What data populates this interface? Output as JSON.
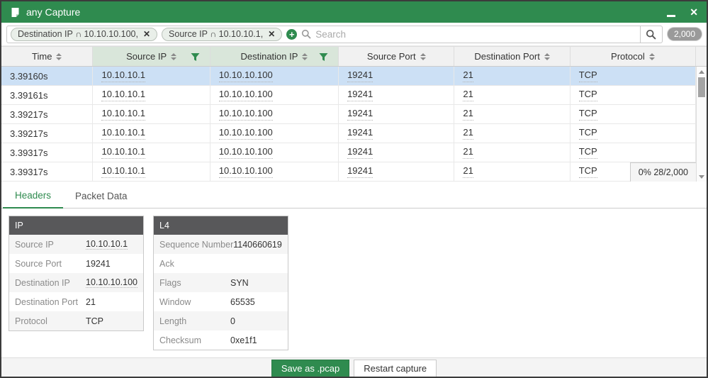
{
  "window": {
    "title": "any Capture"
  },
  "colors": {
    "accent_green": "#2f8b4f",
    "selected_row_blue": "#cce0f5",
    "filtered_header_green": "#d9e6da",
    "detail_header_gray": "#58585a"
  },
  "icons": {
    "app": "document-icon",
    "minimize": "minimize-bar",
    "close": "✕",
    "chip_remove": "✕",
    "add_filter": "+",
    "search": "magnifier",
    "sort": "up-down-triangles",
    "column_filter": "funnel",
    "scroll_up": "▲",
    "scroll_down": "▼"
  },
  "filter_bar": {
    "chips": [
      {
        "label": "Destination IP ∩ 10.10.10.100,"
      },
      {
        "label": "Source IP ∩ 10.10.10.1,"
      }
    ],
    "search_placeholder": "Search",
    "count_badge": "2,000"
  },
  "table": {
    "columns": [
      {
        "label": "Time",
        "filtered": false
      },
      {
        "label": "Source IP",
        "filtered": true
      },
      {
        "label": "Destination IP",
        "filtered": true
      },
      {
        "label": "Source Port",
        "filtered": false
      },
      {
        "label": "Destination Port",
        "filtered": false
      },
      {
        "label": "Protocol",
        "filtered": false
      }
    ],
    "rows": [
      {
        "time": "3.39160s",
        "source_ip": "10.10.10.1",
        "destination_ip": "10.10.10.100",
        "source_port": "19241",
        "destination_port": "21",
        "protocol": "TCP",
        "selected": true
      },
      {
        "time": "3.39161s",
        "source_ip": "10.10.10.1",
        "destination_ip": "10.10.10.100",
        "source_port": "19241",
        "destination_port": "21",
        "protocol": "TCP",
        "selected": false
      },
      {
        "time": "3.39217s",
        "source_ip": "10.10.10.1",
        "destination_ip": "10.10.10.100",
        "source_port": "19241",
        "destination_port": "21",
        "protocol": "TCP",
        "selected": false
      },
      {
        "time": "3.39217s",
        "source_ip": "10.10.10.1",
        "destination_ip": "10.10.10.100",
        "source_port": "19241",
        "destination_port": "21",
        "protocol": "TCP",
        "selected": false
      },
      {
        "time": "3.39317s",
        "source_ip": "10.10.10.1",
        "destination_ip": "10.10.10.100",
        "source_port": "19241",
        "destination_port": "21",
        "protocol": "TCP",
        "selected": false
      },
      {
        "time": "3.39317s",
        "source_ip": "10.10.10.1",
        "destination_ip": "10.10.10.100",
        "source_port": "19241",
        "destination_port": "21",
        "protocol": "TCP",
        "selected": false
      }
    ],
    "progress_badge": "0% 28/2,000"
  },
  "tabs": [
    {
      "label": "Headers",
      "active": true
    },
    {
      "label": "Packet Data",
      "active": false
    }
  ],
  "details": {
    "tables": [
      {
        "title": "IP",
        "rows": [
          {
            "label": "Source IP",
            "value": "10.10.10.1"
          },
          {
            "label": "Source Port",
            "value": "19241"
          },
          {
            "label": "Destination IP",
            "value": "10.10.10.100"
          },
          {
            "label": "Destination Port",
            "value": "21"
          },
          {
            "label": "Protocol",
            "value": "TCP"
          }
        ]
      },
      {
        "title": "L4",
        "rows": [
          {
            "label": "Sequence Number",
            "value": "1140660619"
          },
          {
            "label": "Ack",
            "value": ""
          },
          {
            "label": "Flags",
            "value": "SYN"
          },
          {
            "label": "Window",
            "value": "65535"
          },
          {
            "label": "Length",
            "value": "0"
          },
          {
            "label": "Checksum",
            "value": "0xe1f1"
          }
        ]
      }
    ]
  },
  "footer": {
    "save_label": "Save as .pcap",
    "restart_label": "Restart capture"
  }
}
